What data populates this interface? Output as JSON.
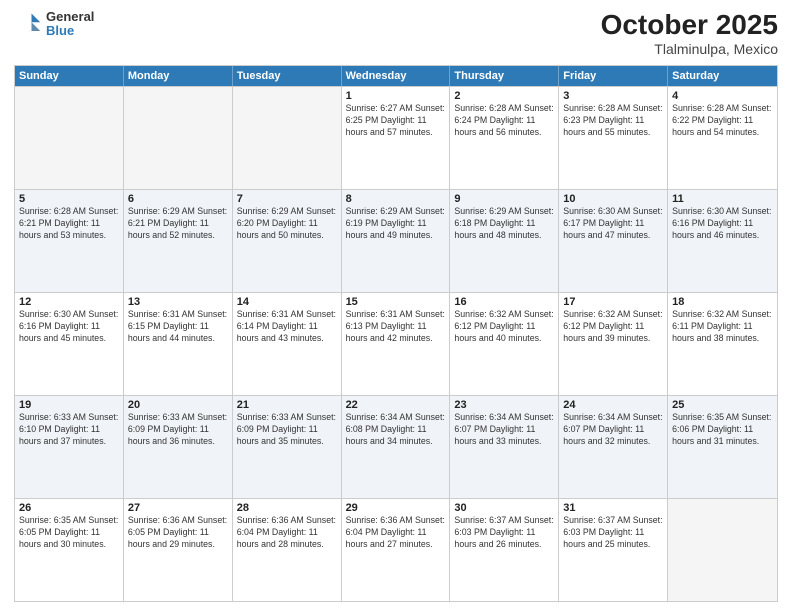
{
  "header": {
    "logo_line1": "General",
    "logo_line2": "Blue",
    "title": "October 2025",
    "subtitle": "Tlalminulpa, Mexico"
  },
  "weekdays": [
    "Sunday",
    "Monday",
    "Tuesday",
    "Wednesday",
    "Thursday",
    "Friday",
    "Saturday"
  ],
  "rows": [
    [
      {
        "day": "",
        "info": "",
        "empty": true
      },
      {
        "day": "",
        "info": "",
        "empty": true
      },
      {
        "day": "",
        "info": "",
        "empty": true
      },
      {
        "day": "1",
        "info": "Sunrise: 6:27 AM\nSunset: 6:25 PM\nDaylight: 11 hours\nand 57 minutes."
      },
      {
        "day": "2",
        "info": "Sunrise: 6:28 AM\nSunset: 6:24 PM\nDaylight: 11 hours\nand 56 minutes."
      },
      {
        "day": "3",
        "info": "Sunrise: 6:28 AM\nSunset: 6:23 PM\nDaylight: 11 hours\nand 55 minutes."
      },
      {
        "day": "4",
        "info": "Sunrise: 6:28 AM\nSunset: 6:22 PM\nDaylight: 11 hours\nand 54 minutes."
      }
    ],
    [
      {
        "day": "5",
        "info": "Sunrise: 6:28 AM\nSunset: 6:21 PM\nDaylight: 11 hours\nand 53 minutes."
      },
      {
        "day": "6",
        "info": "Sunrise: 6:29 AM\nSunset: 6:21 PM\nDaylight: 11 hours\nand 52 minutes."
      },
      {
        "day": "7",
        "info": "Sunrise: 6:29 AM\nSunset: 6:20 PM\nDaylight: 11 hours\nand 50 minutes."
      },
      {
        "day": "8",
        "info": "Sunrise: 6:29 AM\nSunset: 6:19 PM\nDaylight: 11 hours\nand 49 minutes."
      },
      {
        "day": "9",
        "info": "Sunrise: 6:29 AM\nSunset: 6:18 PM\nDaylight: 11 hours\nand 48 minutes."
      },
      {
        "day": "10",
        "info": "Sunrise: 6:30 AM\nSunset: 6:17 PM\nDaylight: 11 hours\nand 47 minutes."
      },
      {
        "day": "11",
        "info": "Sunrise: 6:30 AM\nSunset: 6:16 PM\nDaylight: 11 hours\nand 46 minutes."
      }
    ],
    [
      {
        "day": "12",
        "info": "Sunrise: 6:30 AM\nSunset: 6:16 PM\nDaylight: 11 hours\nand 45 minutes."
      },
      {
        "day": "13",
        "info": "Sunrise: 6:31 AM\nSunset: 6:15 PM\nDaylight: 11 hours\nand 44 minutes."
      },
      {
        "day": "14",
        "info": "Sunrise: 6:31 AM\nSunset: 6:14 PM\nDaylight: 11 hours\nand 43 minutes."
      },
      {
        "day": "15",
        "info": "Sunrise: 6:31 AM\nSunset: 6:13 PM\nDaylight: 11 hours\nand 42 minutes."
      },
      {
        "day": "16",
        "info": "Sunrise: 6:32 AM\nSunset: 6:12 PM\nDaylight: 11 hours\nand 40 minutes."
      },
      {
        "day": "17",
        "info": "Sunrise: 6:32 AM\nSunset: 6:12 PM\nDaylight: 11 hours\nand 39 minutes."
      },
      {
        "day": "18",
        "info": "Sunrise: 6:32 AM\nSunset: 6:11 PM\nDaylight: 11 hours\nand 38 minutes."
      }
    ],
    [
      {
        "day": "19",
        "info": "Sunrise: 6:33 AM\nSunset: 6:10 PM\nDaylight: 11 hours\nand 37 minutes."
      },
      {
        "day": "20",
        "info": "Sunrise: 6:33 AM\nSunset: 6:09 PM\nDaylight: 11 hours\nand 36 minutes."
      },
      {
        "day": "21",
        "info": "Sunrise: 6:33 AM\nSunset: 6:09 PM\nDaylight: 11 hours\nand 35 minutes."
      },
      {
        "day": "22",
        "info": "Sunrise: 6:34 AM\nSunset: 6:08 PM\nDaylight: 11 hours\nand 34 minutes."
      },
      {
        "day": "23",
        "info": "Sunrise: 6:34 AM\nSunset: 6:07 PM\nDaylight: 11 hours\nand 33 minutes."
      },
      {
        "day": "24",
        "info": "Sunrise: 6:34 AM\nSunset: 6:07 PM\nDaylight: 11 hours\nand 32 minutes."
      },
      {
        "day": "25",
        "info": "Sunrise: 6:35 AM\nSunset: 6:06 PM\nDaylight: 11 hours\nand 31 minutes."
      }
    ],
    [
      {
        "day": "26",
        "info": "Sunrise: 6:35 AM\nSunset: 6:05 PM\nDaylight: 11 hours\nand 30 minutes."
      },
      {
        "day": "27",
        "info": "Sunrise: 6:36 AM\nSunset: 6:05 PM\nDaylight: 11 hours\nand 29 minutes."
      },
      {
        "day": "28",
        "info": "Sunrise: 6:36 AM\nSunset: 6:04 PM\nDaylight: 11 hours\nand 28 minutes."
      },
      {
        "day": "29",
        "info": "Sunrise: 6:36 AM\nSunset: 6:04 PM\nDaylight: 11 hours\nand 27 minutes."
      },
      {
        "day": "30",
        "info": "Sunrise: 6:37 AM\nSunset: 6:03 PM\nDaylight: 11 hours\nand 26 minutes."
      },
      {
        "day": "31",
        "info": "Sunrise: 6:37 AM\nSunset: 6:03 PM\nDaylight: 11 hours\nand 25 minutes."
      },
      {
        "day": "",
        "info": "",
        "empty": true
      }
    ]
  ]
}
